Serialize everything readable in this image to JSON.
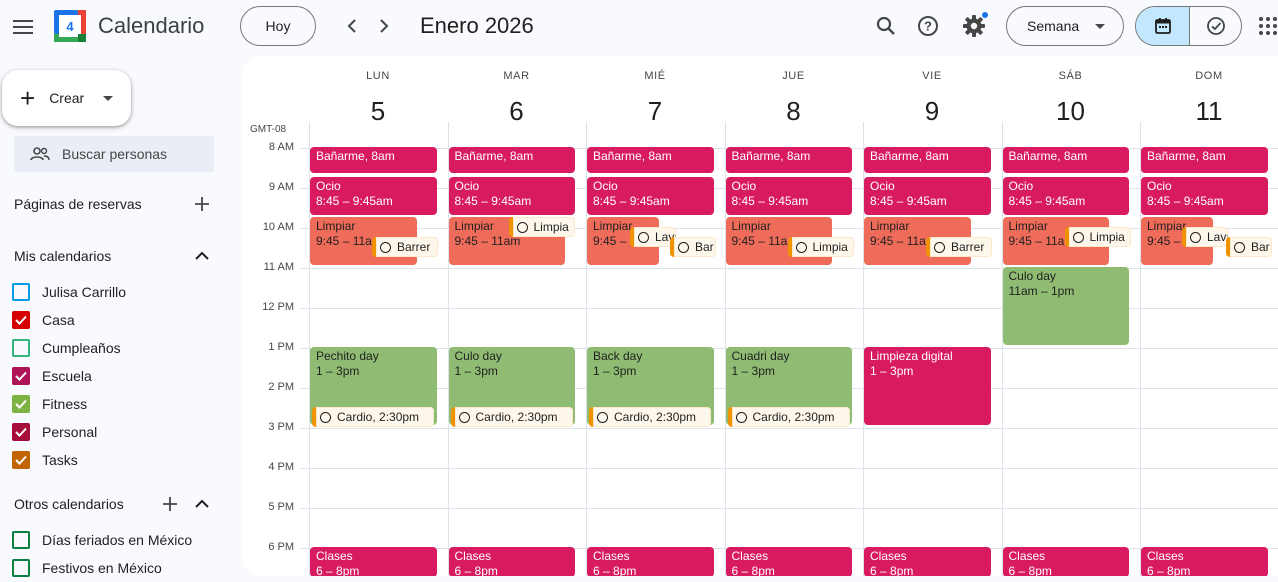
{
  "app": {
    "title": "Calendario",
    "logo_day": "4"
  },
  "header": {
    "today_label": "Hoy",
    "month_label": "Enero 2026",
    "view_label": "Semana"
  },
  "sidebar": {
    "create_label": "Crear",
    "people_search_placeholder": "Buscar personas",
    "booking_pages_label": "Páginas de reservas",
    "my_calendars_label": "Mis calendarios",
    "my_calendars": [
      {
        "name": "Julisa Carrillo",
        "color": "#039be5",
        "checked": false
      },
      {
        "name": "Casa",
        "color": "#d50000",
        "checked": true
      },
      {
        "name": "Cumpleaños",
        "color": "#33b679",
        "checked": false
      },
      {
        "name": "Escuela",
        "color": "#ad1457",
        "checked": true
      },
      {
        "name": "Fitness",
        "color": "#7cb342",
        "checked": true
      },
      {
        "name": "Personal",
        "color": "#a50e3a",
        "checked": true
      },
      {
        "name": "Tasks",
        "color": "#c26401",
        "checked": true
      }
    ],
    "other_calendars_label": "Otros calendarios",
    "other_calendars": [
      {
        "name": "Días feriados en México",
        "color": "#0b8043",
        "checked": false
      },
      {
        "name": "Festivos en México",
        "color": "#0b8043",
        "checked": false
      }
    ]
  },
  "calendar": {
    "timezone": "GMT-08",
    "days": [
      {
        "dow": "LUN",
        "num": "5"
      },
      {
        "dow": "MAR",
        "num": "6"
      },
      {
        "dow": "MIÉ",
        "num": "7"
      },
      {
        "dow": "JUE",
        "num": "8"
      },
      {
        "dow": "VIE",
        "num": "9"
      },
      {
        "dow": "SÁB",
        "num": "10"
      },
      {
        "dow": "DOM",
        "num": "11"
      }
    ],
    "hours": [
      "8 AM",
      "9 AM",
      "10 AM",
      "11 AM",
      "12 PM",
      "1 PM",
      "2 PM",
      "3 PM",
      "4 PM",
      "5 PM",
      "6 PM"
    ],
    "events": {
      "banarme": {
        "title": "Bañarme, 8am"
      },
      "ocio": {
        "title": "Ocio",
        "time": "8:45 – 9:45am"
      },
      "limpiar": {
        "title": "Limpiar",
        "time_short": "9:45 – 11am",
        "time_clip": "9:45 – 11a",
        "time_tiny": "9:45 –"
      },
      "clases": {
        "title": "Clases",
        "time": "6 – 8pm"
      },
      "pechito": {
        "title": "Pechito day",
        "time": "1 – 3pm"
      },
      "culo_mar": {
        "title": "Culo day",
        "time": "1 – 3pm"
      },
      "back": {
        "title": "Back day",
        "time": "1 – 3pm"
      },
      "cuadri": {
        "title": "Cuadri day",
        "time": "1 – 3pm"
      },
      "limpieza_digital": {
        "title": "Limpieza digital",
        "time": "1 – 3pm"
      },
      "culo_sab": {
        "title": "Culo day",
        "time": "11am – 1pm"
      }
    },
    "tasks": {
      "barrer": "Barrer",
      "limpia": "Limpia",
      "lavar": "Lavar ·½",
      "bar": "Bar",
      "cardio": "Cardio, 2:30pm"
    }
  }
}
